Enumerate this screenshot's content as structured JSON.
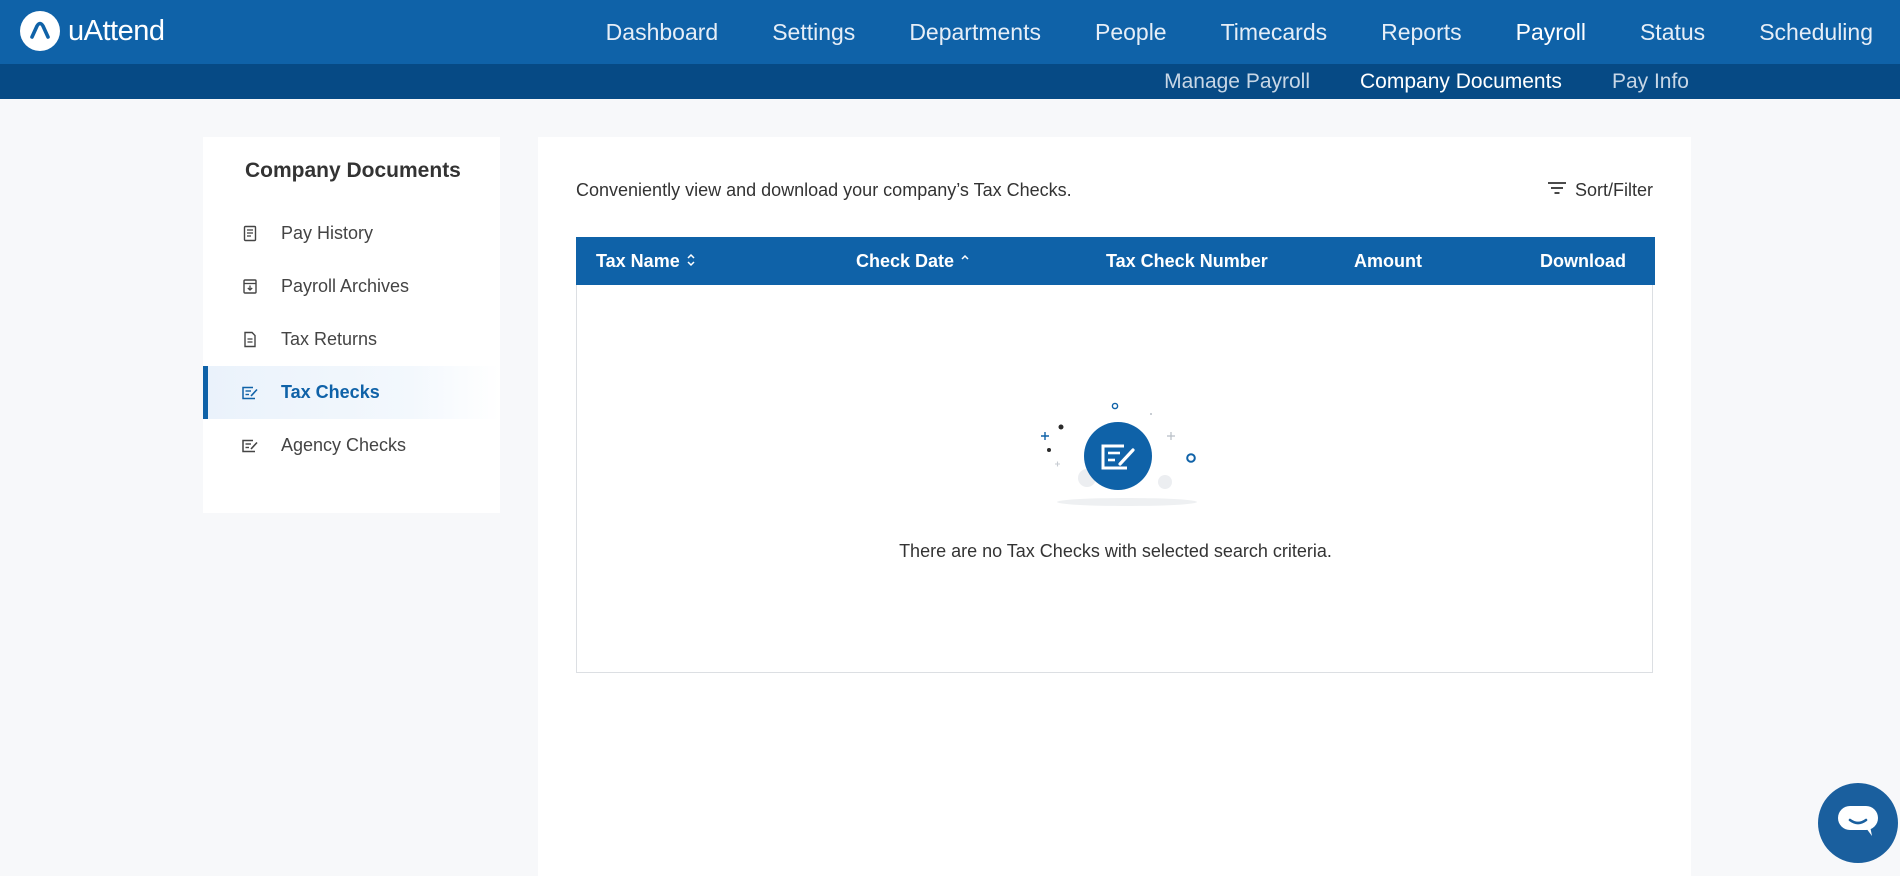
{
  "app": {
    "logo_text": "uAttend"
  },
  "nav": {
    "items": [
      {
        "label": "Dashboard"
      },
      {
        "label": "Settings"
      },
      {
        "label": "Departments"
      },
      {
        "label": "People"
      },
      {
        "label": "Timecards"
      },
      {
        "label": "Reports"
      },
      {
        "label": "Payroll",
        "active": true
      },
      {
        "label": "Status"
      },
      {
        "label": "Scheduling"
      }
    ]
  },
  "subnav": {
    "items": [
      {
        "label": "Manage Payroll"
      },
      {
        "label": "Company Documents",
        "active": true
      },
      {
        "label": "Pay Info"
      }
    ]
  },
  "sidebar": {
    "title": "Company Documents",
    "items": [
      {
        "label": "Pay History",
        "icon": "receipt-icon"
      },
      {
        "label": "Payroll Archives",
        "icon": "archive-icon"
      },
      {
        "label": "Tax Returns",
        "icon": "document-icon"
      },
      {
        "label": "Tax Checks",
        "icon": "check-icon",
        "active": true
      },
      {
        "label": "Agency Checks",
        "icon": "check-icon"
      }
    ]
  },
  "main": {
    "description": "Conveniently view and download your company’s Tax Checks.",
    "sort_filter_label": "Sort/Filter",
    "table": {
      "columns": [
        "Tax Name",
        "Check Date",
        "Tax Check Number",
        "Amount",
        "Download"
      ],
      "rows": [],
      "empty_message": "There are no Tax Checks with selected search criteria."
    }
  },
  "colors": {
    "primary": "#0f62a8",
    "subbar": "#064a85",
    "background": "#f7f8fa"
  }
}
